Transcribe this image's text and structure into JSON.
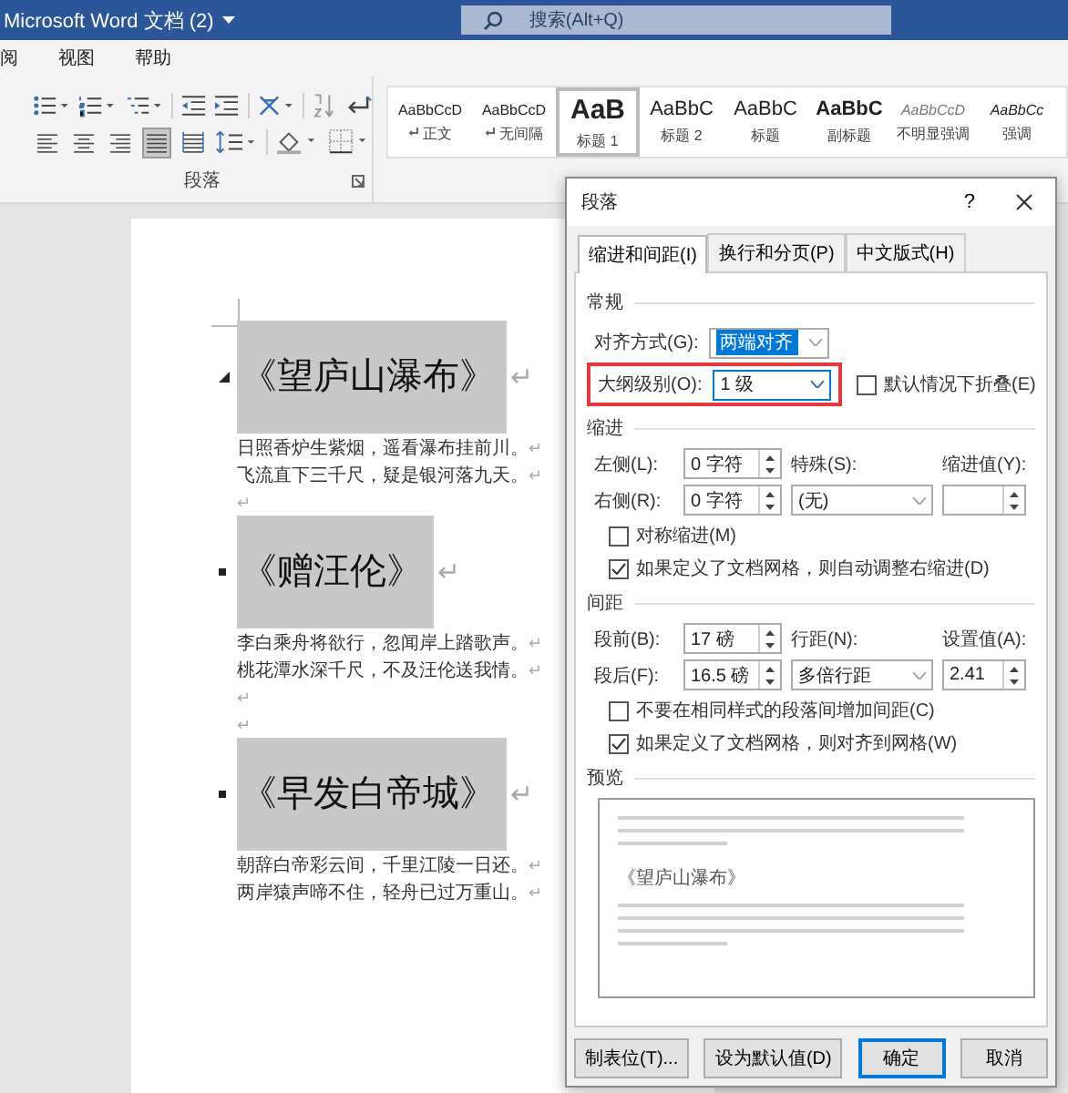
{
  "window": {
    "title": "Microsoft Word 文档 (2)",
    "search_placeholder": "搜索(Alt+Q)"
  },
  "menu": [
    {
      "label": "阅"
    },
    {
      "label": "视图"
    },
    {
      "label": "帮助"
    }
  ],
  "ribbon": {
    "paragraph_group": {
      "label": "段落",
      "align_buttons": [
        {
          "selected": false
        },
        {
          "selected": false
        },
        {
          "selected": false
        },
        {
          "selected": true
        },
        {
          "selected": false
        }
      ]
    },
    "styles": [
      {
        "preview": "AaBbCcD",
        "label": "正文",
        "kind": "normal",
        "mark": true,
        "selected": false
      },
      {
        "preview": "AaBbCcD",
        "label": "无间隔",
        "kind": "normal",
        "mark": true,
        "selected": false
      },
      {
        "preview": "AaB",
        "label": "标题 1",
        "kind": "heading1",
        "mark": false,
        "selected": true
      },
      {
        "preview": "AaBbC",
        "label": "标题 2",
        "kind": "heading2",
        "mark": false,
        "selected": false
      },
      {
        "preview": "AaBbC",
        "label": "标题",
        "kind": "title",
        "mark": false,
        "selected": false
      },
      {
        "preview": "AaBbC",
        "label": "副标题",
        "kind": "subtitle",
        "mark": false,
        "selected": false
      },
      {
        "preview": "AaBbCcD",
        "label": "不明显强调",
        "kind": "subtle",
        "mark": false,
        "selected": false
      },
      {
        "preview": "AaBbCc",
        "label": "强调",
        "kind": "emphasis",
        "mark": false,
        "selected": false
      }
    ]
  },
  "document": {
    "blocks": [
      {
        "kind": "heading",
        "text": "《望庐山瀑布》",
        "mark": "↵",
        "collapse_handle": true
      },
      {
        "kind": "body",
        "text": "日照香炉生紫烟，遥看瀑布挂前川。",
        "mark": "↵"
      },
      {
        "kind": "body",
        "text": "飞流直下三千尺，疑是银河落九天。",
        "mark": "↵"
      },
      {
        "kind": "empty",
        "mark": "↵"
      },
      {
        "kind": "heading",
        "text": "《赠汪伦》",
        "mark": "↵",
        "collapse_handle": false
      },
      {
        "kind": "body",
        "text": "李白乘舟将欲行，忽闻岸上踏歌声。",
        "mark": "↵"
      },
      {
        "kind": "body",
        "text": "桃花潭水深千尺，不及汪伦送我情。",
        "mark": "↵"
      },
      {
        "kind": "empty",
        "mark": "↵"
      },
      {
        "kind": "empty",
        "mark": "↵"
      },
      {
        "kind": "heading",
        "text": "《早发白帝城》",
        "mark": "↵",
        "collapse_handle": false
      },
      {
        "kind": "body",
        "text": "朝辞白帝彩云间，千里江陵一日还。",
        "mark": "↵"
      },
      {
        "kind": "body",
        "text": "两岸猿声啼不住，轻舟已过万重山。",
        "mark": "↵"
      }
    ]
  },
  "dialog": {
    "title": "段落",
    "help": "?",
    "tabs": [
      {
        "label": "缩进和间距(I)",
        "selected": true
      },
      {
        "label": "换行和分页(P)",
        "selected": false
      },
      {
        "label": "中文版式(H)",
        "selected": false
      }
    ],
    "general": {
      "heading": "常规",
      "alignment": {
        "label": "对齐方式(G):",
        "value": "两端对齐"
      },
      "outline": {
        "label": "大纲级别(O):",
        "value": "1 级",
        "highlighted": true
      },
      "collapse": {
        "label": "默认情况下折叠(E)",
        "checked": false
      }
    },
    "indent": {
      "heading": "缩进",
      "left": {
        "label": "左侧(L):",
        "value": "0 字符"
      },
      "right": {
        "label": "右侧(R):",
        "value": "0 字符"
      },
      "special": {
        "label": "特殊(S):",
        "value": "(无)"
      },
      "by": {
        "label": "缩进值(Y):"
      },
      "checks": [
        {
          "label": "对称缩进(M)",
          "checked": false
        },
        {
          "label": "如果定义了文档网格，则自动调整右缩进(D)",
          "checked": true
        }
      ]
    },
    "spacing": {
      "heading": "间距",
      "before": {
        "label": "段前(B):",
        "value": "17 磅"
      },
      "after": {
        "label": "段后(F):",
        "value": "16.5 磅"
      },
      "line": {
        "label": "行距(N):",
        "value": "多倍行距"
      },
      "at": {
        "label": "设置值(A):",
        "value": "2.41"
      },
      "checks": [
        {
          "label": "不要在相同样式的段落间增加间距(C)",
          "checked": false
        },
        {
          "label": "如果定义了文档网格，则对齐到网格(W)",
          "checked": true
        }
      ]
    },
    "preview": {
      "heading": "预览",
      "sample": "《望庐山瀑布》"
    },
    "buttons": [
      {
        "label": "制表位(T)...",
        "default": false
      },
      {
        "label": "设为默认值(D)",
        "default": false
      },
      {
        "label": "确定",
        "default": true
      },
      {
        "label": "取消",
        "default": false
      }
    ]
  }
}
